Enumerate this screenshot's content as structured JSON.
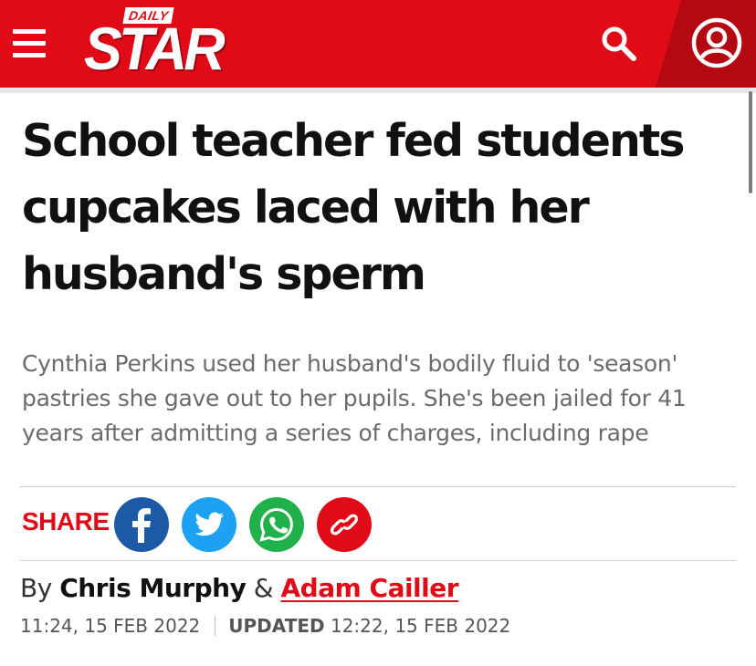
{
  "header": {
    "logo_small": "DAILY",
    "logo_main": "STAR",
    "brand_color": "#e10a17",
    "icons": [
      "hamburger-menu-icon",
      "search-icon",
      "user-account-icon"
    ]
  },
  "article": {
    "headline": "School teacher fed students cupcakes laced with her husband's sperm",
    "standfirst": "Cynthia Perkins used her husband's bodily fluid to 'season' pastries she gave out to her pupils. She's been jailed for 41 years after admitting a series of charges, including rape",
    "share_label": "SHARE",
    "share_buttons": [
      {
        "name": "facebook",
        "icon": "facebook-icon",
        "color": "#1c5aa6"
      },
      {
        "name": "twitter",
        "icon": "twitter-icon",
        "color": "#1da1f2"
      },
      {
        "name": "whatsapp",
        "icon": "whatsapp-icon",
        "color": "#21b14a"
      },
      {
        "name": "copy-link",
        "icon": "link-icon",
        "color": "#e10a17"
      }
    ],
    "byline_prefix": "By",
    "author_1": "Chris Murphy",
    "byline_joiner": "&",
    "author_2": "Adam Cailler",
    "published": "11:24, 15 FEB 2022",
    "updated_label": "UPDATED",
    "updated": "12:22, 15 FEB 2022"
  }
}
